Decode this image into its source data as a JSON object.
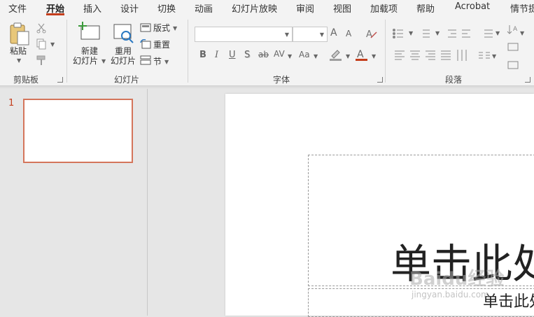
{
  "menu": {
    "tabs": [
      "文件",
      "开始",
      "插入",
      "设计",
      "切换",
      "动画",
      "幻灯片放映",
      "审阅",
      "视图",
      "加载项",
      "帮助",
      "Acrobat",
      "情节提"
    ],
    "active_tab": "开始"
  },
  "ribbon": {
    "clipboard": {
      "paste_label": "粘贴",
      "group_label": "剪贴板"
    },
    "slides": {
      "new_slide_line1": "新建",
      "new_slide_line2": "幻灯片",
      "reuse_line1": "重用",
      "reuse_line2": "幻灯片",
      "layout_label": "版式",
      "reset_label": "重置",
      "section_label": "节",
      "group_label": "幻灯片"
    },
    "font": {
      "font_name_value": "",
      "font_size_value": "",
      "bold": "B",
      "italic": "I",
      "underline": "U",
      "shadow": "S",
      "strike": "ab",
      "spacing": "AV",
      "case": "Aa",
      "grow": "A",
      "shrink": "A",
      "group_label": "字体"
    },
    "paragraph": {
      "group_label": "段落"
    }
  },
  "thumbnails": {
    "slide_number": "1"
  },
  "slide": {
    "title_placeholder": "单击此处",
    "subtitle_placeholder": "单击此处"
  },
  "watermark": {
    "line1": "Baidu经验",
    "line2": "jingyan.baidu.com"
  },
  "colors": {
    "accent": "#c43e1c",
    "thumb_border": "#d4755b"
  }
}
